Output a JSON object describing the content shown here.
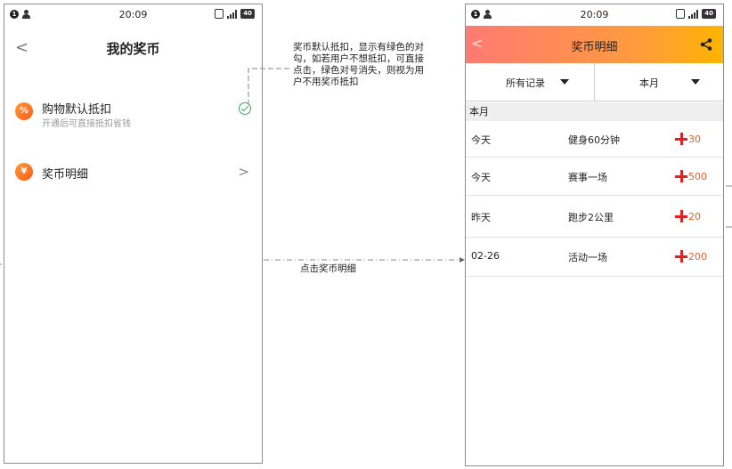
{
  "status_bar": {
    "time": "20:09",
    "notification_badge": "1",
    "battery": "40"
  },
  "screen_my_coins": {
    "title": "我的奖币",
    "back_glyph": "<",
    "rows": [
      {
        "title": "购物默认抵扣",
        "subtitle": "开通后可直接抵扣省钱",
        "icon": "percent-icon",
        "icon_glyph": "%",
        "trailing": "check-circle-icon"
      },
      {
        "title": "奖币明细",
        "icon": "yen-icon",
        "icon_glyph": "¥",
        "trailing": "chevron-right-icon",
        "trailing_glyph": ">"
      }
    ]
  },
  "screen_coin_details": {
    "title": "奖币明细",
    "back_glyph": "<",
    "filters": [
      {
        "label": "所有记录"
      },
      {
        "label": "本月"
      }
    ],
    "section_title": "本月",
    "records": [
      {
        "date": "今天",
        "description": "健身60分钟",
        "amount": "30"
      },
      {
        "date": "今天",
        "description": "赛事一场",
        "amount": "500"
      },
      {
        "date": "昨天",
        "description": "跑步2公里",
        "amount": "20"
      },
      {
        "date": "02-26",
        "description": "活动一场",
        "amount": "200"
      }
    ]
  },
  "annotations": {
    "default_deduct_note": "奖币默认抵扣，显示有绿色的对勾，如若用户不想抵扣，可直接点击，绿色对号消失，则视为用户不用奖币抵扣",
    "tap_details_note": "点击奖币明细"
  },
  "colors": {
    "header_gradient_start": "#ff7a73",
    "header_gradient_end": "#ffb400",
    "check_green": "#3aa85a",
    "plus_red": "#e02222",
    "amount_orange": "#e8622a",
    "icon_orange": "#ff7a2a"
  }
}
